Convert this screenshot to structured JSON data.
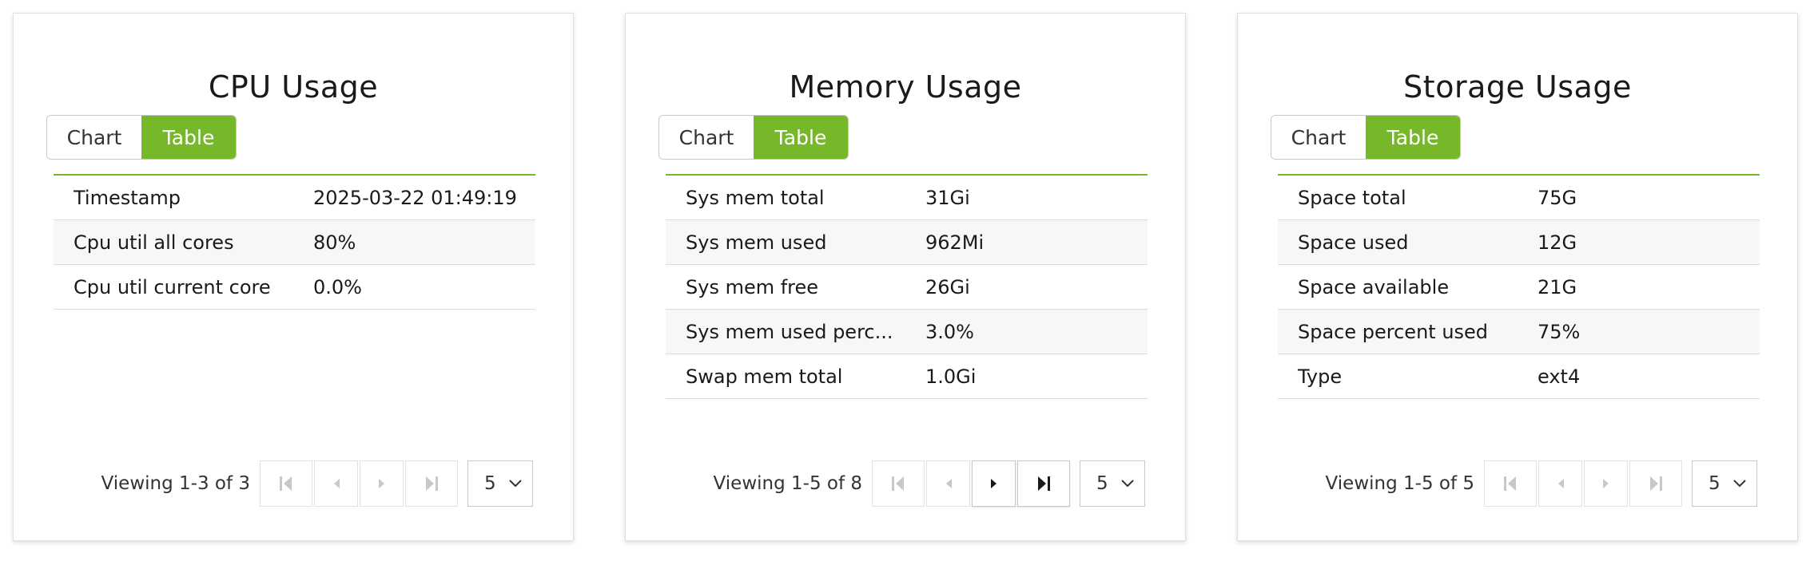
{
  "toggle": {
    "chart_label": "Chart",
    "table_label": "Table"
  },
  "cards": [
    {
      "title": "CPU Usage",
      "rows": [
        {
          "key": "Timestamp",
          "value": "2025-03-22 01:49:19"
        },
        {
          "key": "Cpu util all cores",
          "value": "80%"
        },
        {
          "key": "Cpu util current core",
          "value": "0.0%"
        }
      ],
      "viewing": "Viewing 1-3 of 3",
      "page_size": "5"
    },
    {
      "title": "Memory Usage",
      "rows": [
        {
          "key": "Sys mem total",
          "value": "31Gi"
        },
        {
          "key": "Sys mem used",
          "value": "962Mi"
        },
        {
          "key": "Sys mem free",
          "value": "26Gi"
        },
        {
          "key": "Sys mem used perc...",
          "value": "3.0%"
        },
        {
          "key": "Swap mem total",
          "value": "1.0Gi"
        }
      ],
      "viewing": "Viewing 1-5 of 8",
      "page_size": "5"
    },
    {
      "title": "Storage Usage",
      "rows": [
        {
          "key": "Space total",
          "value": "75G"
        },
        {
          "key": "Space used",
          "value": "12G"
        },
        {
          "key": "Space available",
          "value": "21G"
        },
        {
          "key": "Space percent used",
          "value": "75%"
        },
        {
          "key": "Type",
          "value": "ext4"
        }
      ],
      "viewing": "Viewing 1-5 of 5",
      "page_size": "5"
    }
  ],
  "icons": {
    "first": "first-page-icon",
    "prev": "previous-page-icon",
    "next": "next-page-icon",
    "last": "last-page-icon",
    "dropdown": "chevron-down-icon"
  },
  "colors": {
    "accent": "#76b82a",
    "disabled_icon": "#c8c8c8",
    "enabled_icon": "#1a1a1a"
  }
}
